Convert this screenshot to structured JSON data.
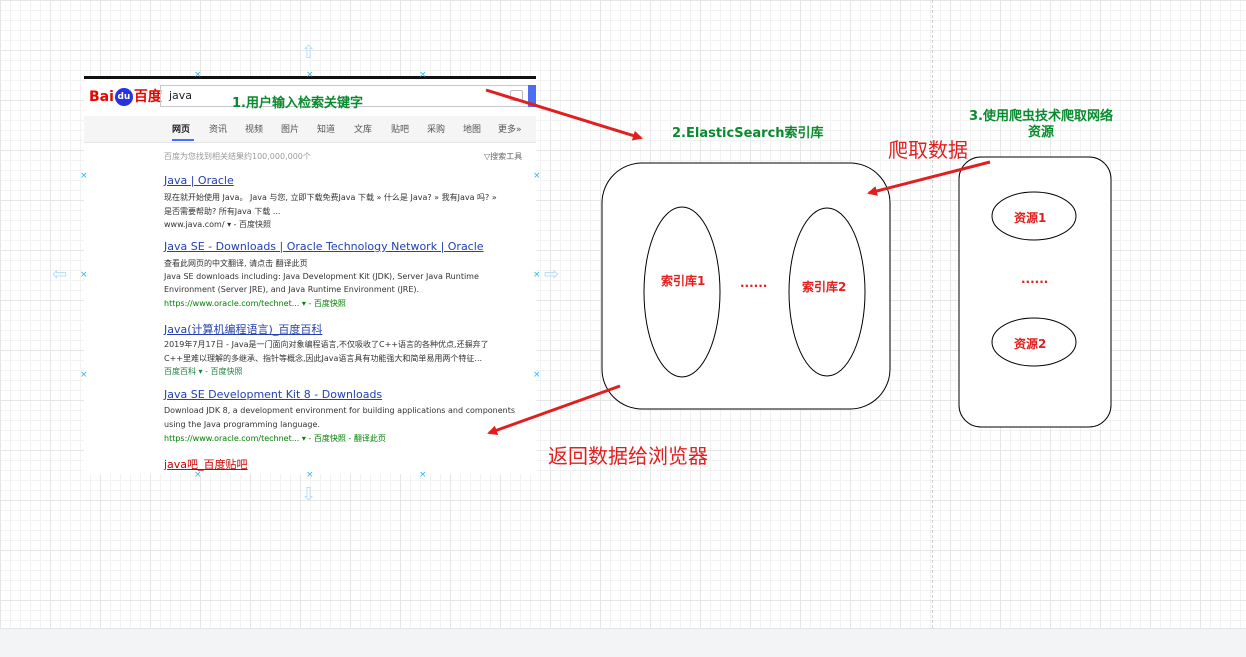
{
  "baidu": {
    "logo_left": "Bai",
    "logo_paw": "du",
    "logo_right": "百度",
    "query": "java",
    "tabs": [
      "网页",
      "资讯",
      "视频",
      "图片",
      "知道",
      "文库",
      "贴吧",
      "采购",
      "地图",
      "更多»"
    ],
    "result_count": "百度为您找到相关结果约100,000,000个",
    "search_tools": "▽搜索工具",
    "results": [
      {
        "title": "Java | Oracle",
        "lines": [
          "现在就开始使用 Java。 Java 与您, 立即下载免费Java 下载 » 什么是 Java? » 我有Java 吗? »",
          "是否需要帮助? 所有Java 下载 ..."
        ],
        "url": "www.java.com/ ▾ - 百度快照"
      },
      {
        "title": "Java SE - Downloads | Oracle Technology Network | Oracle",
        "lines": [
          "查看此网页的中文翻译, 请点击 翻译此页",
          "Java SE downloads including: Java Development Kit (JDK), Server Java Runtime",
          "Environment (Server JRE), and Java Runtime Environment (JRE)."
        ],
        "url": "https://www.oracle.com/technet... ▾ - 百度快照"
      },
      {
        "title": "Java(计算机编程语言)_百度百科",
        "lines": [
          "2019年7月17日 - Java是一门面向对象编程语言,不仅吸收了C++语言的各种优点,还摒弃了",
          "C++里难以理解的多继承、指针等概念,因此Java语言具有功能强大和简单易用两个特征..."
        ],
        "url": "百度百科 ▾ - 百度快照"
      },
      {
        "title": "Java SE Development Kit 8 - Downloads",
        "lines": [
          "Download JDK 8, a development environment for building applications and components",
          "using the Java programming language."
        ],
        "url": "https://www.oracle.com/technet... ▾ - 百度快照 - 翻译此页"
      },
      {
        "title": "java吧_百度贴吧",
        "lines": [],
        "url": ""
      }
    ]
  },
  "labels": {
    "step1": "1.用户输入检索关键字",
    "step2": "2.ElasticSearch索引库",
    "step3_line1": "3.使用爬虫技术爬取网络",
    "step3_line2": "资源",
    "crawl": "爬取数据",
    "return": "返回数据给浏览器"
  },
  "index_store": {
    "items": [
      "索引库1",
      "索引库2"
    ],
    "ellipsis": "......"
  },
  "resources": {
    "items": [
      "资源1",
      "资源2"
    ],
    "ellipsis": "......"
  },
  "colors": {
    "arrow": "#e21f1f",
    "step_label": "#0a8a2e",
    "node_text": "#e21f1f"
  }
}
